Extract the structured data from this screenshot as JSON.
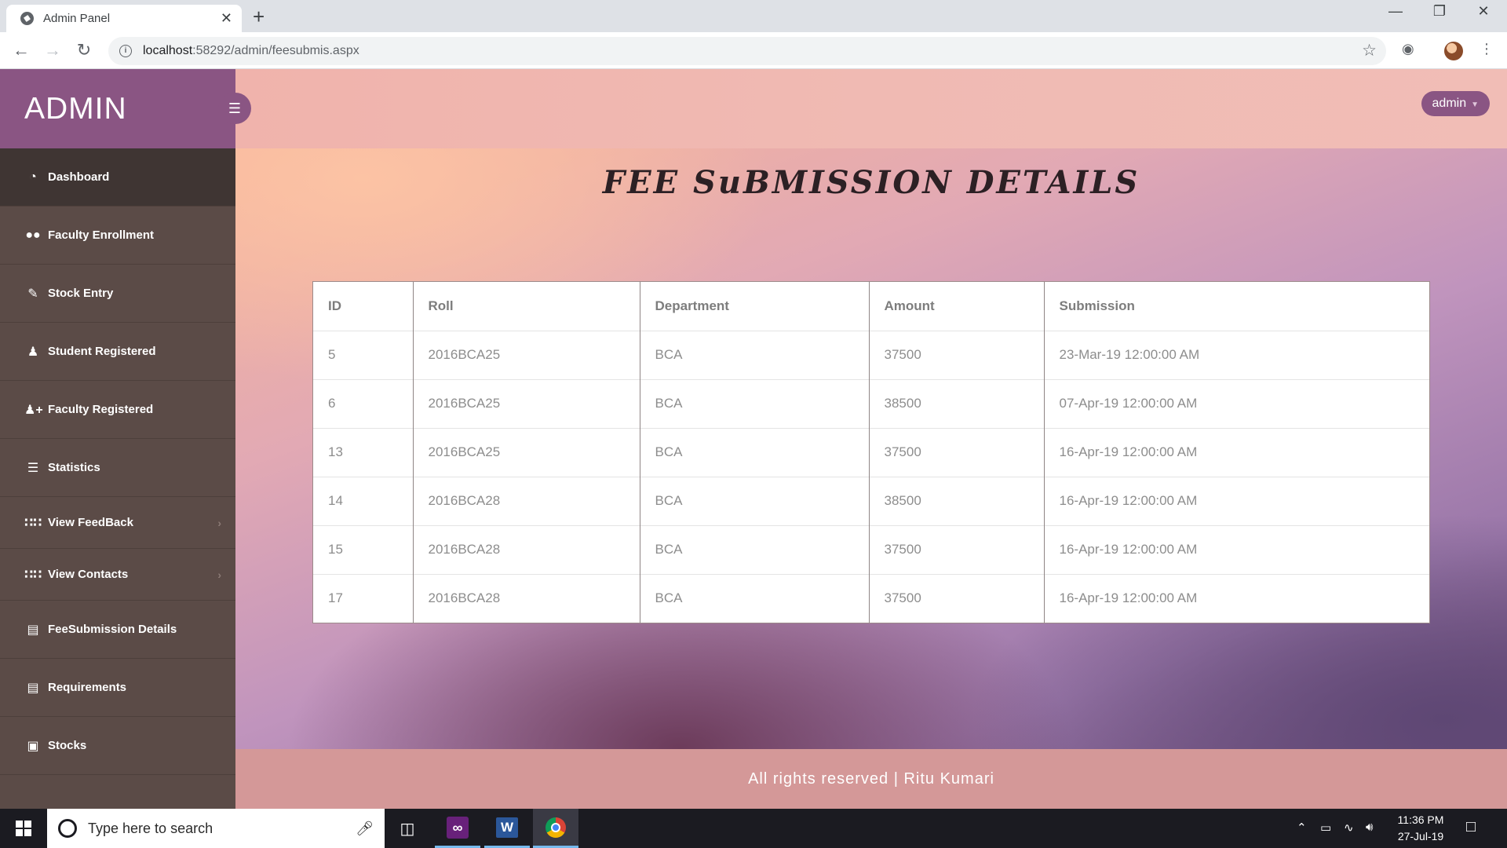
{
  "browser": {
    "tab_title": "Admin Panel",
    "tab_close": "✕",
    "new_tab": "+",
    "url_host": "localhost",
    "url_path": ":58292/admin/feesubmis.aspx"
  },
  "sidebar": {
    "brand": "ADMIN",
    "items": [
      {
        "label": "Dashboard",
        "icon": "dashboard-icon"
      },
      {
        "label": "Faculty Enrollment",
        "icon": "users-icon"
      },
      {
        "label": "Stock Entry",
        "icon": "edit-icon"
      },
      {
        "label": "Student Registered",
        "icon": "user-icon"
      },
      {
        "label": "Faculty Registered",
        "icon": "user-plus-icon"
      },
      {
        "label": "Statistics",
        "icon": "list-icon"
      },
      {
        "label": "View FeedBack",
        "icon": "grid-icon"
      },
      {
        "label": "View Contacts",
        "icon": "grid-icon"
      },
      {
        "label": "FeeSubmission Details",
        "icon": "book-icon"
      },
      {
        "label": "Requirements",
        "icon": "tasks-icon"
      },
      {
        "label": "Stocks",
        "icon": "briefcase-icon"
      }
    ]
  },
  "header": {
    "user_label": "admin"
  },
  "main": {
    "heading": "FEE SuBMISSION DETAILS",
    "table": {
      "columns": [
        "ID",
        "Roll",
        "Department",
        "Amount",
        "Submission"
      ],
      "rows": [
        [
          "5",
          "2016BCA25",
          "BCA",
          "37500",
          "23-Mar-19 12:00:00 AM"
        ],
        [
          "6",
          "2016BCA25",
          "BCA",
          "38500",
          "07-Apr-19 12:00:00 AM"
        ],
        [
          "13",
          "2016BCA25",
          "BCA",
          "37500",
          "16-Apr-19 12:00:00 AM"
        ],
        [
          "14",
          "2016BCA28",
          "BCA",
          "38500",
          "16-Apr-19 12:00:00 AM"
        ],
        [
          "15",
          "2016BCA28",
          "BCA",
          "37500",
          "16-Apr-19 12:00:00 AM"
        ],
        [
          "17",
          "2016BCA28",
          "BCA",
          "37500",
          "16-Apr-19 12:00:00 AM"
        ]
      ]
    }
  },
  "footer": {
    "text": "All rights reserved | Ritu Kumari"
  },
  "taskbar": {
    "search_placeholder": "Type here to search",
    "time": "11:36 PM",
    "date": "27-Jul-19"
  },
  "colors": {
    "sidebar_brand": "#8a5583",
    "sidebar_bg": "#5b4b47",
    "topbar": "#f0b3ac",
    "footer": "#d49898"
  }
}
